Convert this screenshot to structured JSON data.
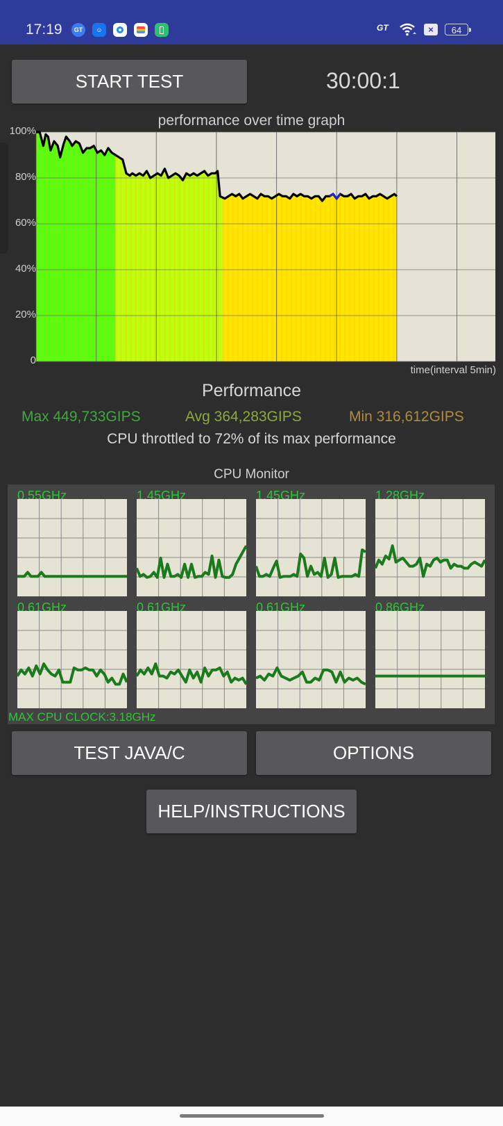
{
  "status_bar": {
    "time": "17:19",
    "left_icons": [
      {
        "name": "gt-app-icon",
        "glyph": "GT",
        "color": "#3b7cf0"
      },
      {
        "name": "game-assistant-icon",
        "glyph": "☺",
        "color": "#1a73f0"
      },
      {
        "name": "camera-app-icon",
        "glyph": "●",
        "color": "#ffffff"
      },
      {
        "name": "wallet-app-icon",
        "glyph": "▤",
        "color": "#ffffff"
      },
      {
        "name": "battery-saver-icon",
        "glyph": "▯",
        "color": "#2fbf71"
      }
    ],
    "gt_label": "GT",
    "wifi_icon": "wifi-icon",
    "sim_icon": "no-sim-icon",
    "sim_glyph": "×",
    "battery_level": "64"
  },
  "controls": {
    "start_test_label": "START TEST",
    "timer": "30:00:1"
  },
  "chart_data": {
    "type": "area",
    "title": "performance over time graph",
    "xlabel": "time(interval 5min)",
    "ylabel": "",
    "y_ticks": [
      "0",
      "20%",
      "40%",
      "60%",
      "80%",
      "100%"
    ],
    "ylim": [
      0,
      100
    ],
    "xlim_minutes": [
      0,
      38.2
    ],
    "x_grid_interval_minutes": 5,
    "grid": true,
    "line_color": "#000000",
    "background_color": "#e5e3d3",
    "x_minutes": [
      0,
      0.3,
      0.6,
      0.8,
      1.0,
      1.2,
      1.5,
      1.8,
      2.0,
      2.3,
      2.5,
      2.8,
      3.0,
      3.3,
      3.6,
      3.9,
      4.2,
      4.5,
      4.8,
      5.1,
      5.4,
      5.7,
      6.0,
      6.3,
      6.6,
      6.9,
      7.2,
      7.5,
      7.8,
      8.0,
      8.3,
      8.6,
      8.9,
      9.2,
      9.5,
      9.8,
      10.1,
      10.4,
      10.7,
      11.0,
      11.3,
      11.6,
      11.9,
      12.2,
      12.5,
      12.8,
      13.1,
      13.4,
      13.7,
      14.0,
      14.3,
      14.6,
      14.9,
      15.1,
      15.3,
      15.7,
      16.0,
      16.3,
      16.6,
      16.9,
      17.2,
      17.5,
      17.8,
      18.1,
      18.4,
      18.7,
      19.0,
      19.3,
      19.6,
      19.9,
      20.2,
      20.5,
      20.8,
      21.1,
      21.4,
      21.7,
      22.0,
      22.3,
      22.6,
      22.9,
      23.2,
      23.5,
      23.8,
      24.1,
      24.4,
      24.7,
      25.0,
      25.3,
      25.6,
      25.9,
      26.2,
      26.5,
      26.8,
      27.1,
      27.4,
      27.7,
      28.0,
      28.3,
      28.6,
      28.9,
      29.2,
      29.5,
      29.8,
      30.0
    ],
    "values": [
      100,
      100,
      94,
      99,
      98,
      92,
      96,
      94,
      89,
      95,
      98,
      96,
      94,
      96,
      95,
      91,
      93,
      93,
      94,
      91,
      92,
      90,
      93,
      91,
      90,
      89,
      88,
      82,
      81,
      82,
      81,
      82,
      81,
      83,
      80,
      81,
      82,
      81,
      84,
      80,
      81,
      82,
      81,
      79,
      82,
      81,
      82,
      81,
      82,
      83,
      81,
      82,
      82,
      83,
      72,
      71,
      72,
      73,
      72,
      73,
      71,
      72,
      73,
      72,
      71,
      73,
      72,
      72,
      71,
      72,
      73,
      72,
      72,
      71,
      73,
      72,
      73,
      72,
      72,
      71,
      72,
      72,
      70,
      72,
      72,
      73,
      71,
      73,
      72,
      72,
      73,
      71,
      72,
      72,
      73,
      71,
      72,
      72,
      73,
      72,
      71,
      72,
      73,
      72
    ],
    "phase_colors": [
      {
        "from_minute": 0,
        "to_minute": 6.6,
        "color": "#55ff10"
      },
      {
        "from_minute": 6.6,
        "to_minute": 15.5,
        "color": "#bfff10"
      },
      {
        "from_minute": 15.5,
        "to_minute": 30.0,
        "color": "#ffe600"
      }
    ],
    "highlight_segment": {
      "from_minute": 24.2,
      "to_minute": 25.3,
      "color": "#2020e0"
    }
  },
  "performance": {
    "title": "Performance",
    "max": "Max 449,733GIPS",
    "avg": "Avg 364,283GIPS",
    "min": "Min 316,612GIPS",
    "max_color": "#3fa83f",
    "avg_color": "#8fa83a",
    "min_color": "#b08c3c",
    "throttle_text": "CPU throttled to 72% of its max performance"
  },
  "cpu_monitor": {
    "title": "CPU Monitor",
    "max_clock": "MAX CPU CLOCK:3.18GHz",
    "cores": [
      {
        "freq": "0.55GHz",
        "values": [
          10,
          10,
          10,
          14,
          10,
          10,
          10,
          14,
          10,
          10,
          10,
          10,
          10,
          10,
          10,
          10,
          10,
          10,
          10,
          10,
          10,
          10,
          10,
          10,
          10,
          10,
          10,
          10,
          10,
          10,
          10,
          10,
          10
        ]
      },
      {
        "freq": "1.45GHz",
        "values": [
          18,
          10,
          12,
          9,
          10,
          14,
          9,
          28,
          9,
          22,
          10,
          10,
          12,
          9,
          22,
          9,
          22,
          9,
          10,
          10,
          14,
          12,
          30,
          9,
          26,
          10,
          9,
          9,
          12,
          22,
          28,
          34,
          40
        ]
      },
      {
        "freq": "1.45GHz",
        "values": [
          20,
          10,
          10,
          12,
          10,
          18,
          25,
          9,
          10,
          10,
          10,
          12,
          10,
          32,
          28,
          10,
          20,
          12,
          14,
          10,
          28,
          9,
          12,
          28,
          9,
          10,
          10,
          10,
          10,
          12,
          10,
          36,
          34
        ]
      },
      {
        "freq": "1.28GHz",
        "values": [
          18,
          26,
          22,
          30,
          27,
          40,
          24,
          26,
          28,
          24,
          20,
          20,
          22,
          28,
          10,
          22,
          20,
          26,
          28,
          24,
          26,
          26,
          18,
          22,
          20,
          20,
          18,
          18,
          22,
          24,
          22,
          20,
          26
        ]
      },
      {
        "freq": "0.61GHz",
        "values": [
          22,
          28,
          24,
          30,
          22,
          32,
          24,
          34,
          28,
          24,
          22,
          28,
          16,
          16,
          16,
          30,
          28,
          28,
          30,
          28,
          28,
          22,
          28,
          24,
          16,
          20,
          14,
          14,
          24,
          16
        ]
      },
      {
        "freq": "0.61GHz",
        "values": [
          22,
          28,
          24,
          30,
          24,
          34,
          22,
          22,
          20,
          26,
          24,
          28,
          22,
          16,
          28,
          20,
          26,
          16,
          30,
          22,
          28,
          28,
          30,
          22,
          26,
          16,
          20,
          18,
          20,
          14
        ]
      },
      {
        "freq": "0.61GHz",
        "values": [
          20,
          22,
          18,
          24,
          22,
          30,
          22,
          20,
          18,
          20,
          22,
          26,
          16,
          16,
          20,
          18,
          28,
          28,
          26,
          16,
          26,
          16,
          20,
          18,
          20,
          16,
          14
        ]
      },
      {
        "freq": "0.86GHz",
        "values": [
          22,
          22,
          22,
          22,
          22,
          22,
          22,
          22,
          22,
          22
        ]
      }
    ]
  },
  "buttons": {
    "test_java_c": "TEST JAVA/C",
    "options": "OPTIONS",
    "help": "HELP/INSTRUCTIONS"
  }
}
